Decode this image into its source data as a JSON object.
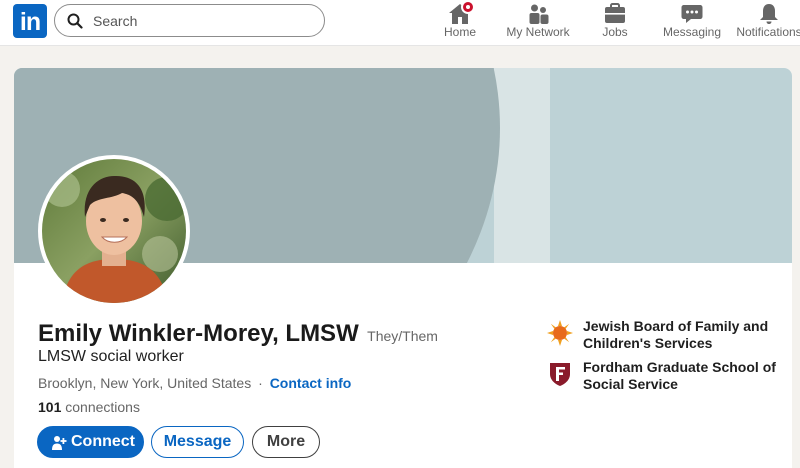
{
  "header": {
    "logo_text": "in",
    "search": {
      "placeholder": "Search",
      "value": ""
    },
    "nav": {
      "home": "Home",
      "network": "My Network",
      "jobs": "Jobs",
      "messaging": "Messaging",
      "notifications": "Notifications"
    },
    "brand_color": "#0a66c2",
    "notification_dot_color": "#cb112d"
  },
  "profile": {
    "name": "Emily Winkler-Morey, LMSW",
    "pronouns": "They/Them",
    "headline": "LMSW social worker",
    "location": "Brooklyn, New York, United States",
    "separator": "·",
    "contact_info": "Contact info",
    "connections_count": "101",
    "connections_label": "connections",
    "actions": {
      "connect": "Connect",
      "message": "Message",
      "more": "More"
    },
    "experience": [
      {
        "name": "Jewish Board of Family and Children's Services",
        "icon": "sun-logo-icon"
      },
      {
        "name": "Fordham Graduate School of Social Service",
        "icon": "fordham-shield-icon"
      }
    ]
  }
}
